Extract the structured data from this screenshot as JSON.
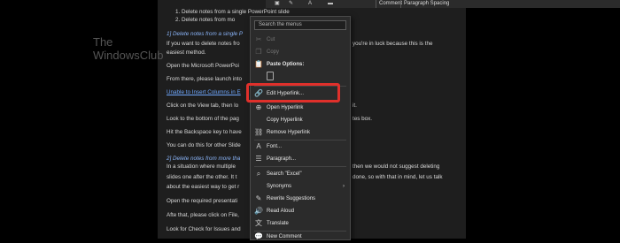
{
  "toolbar": {
    "comment_label": "Comment",
    "paragraph_spacing_label": "Paragraph Spacing",
    "icons": [
      "format-icon",
      "paint-icon"
    ]
  },
  "watermark": {
    "line1": "The",
    "line2": "WindowsClub"
  },
  "document": {
    "list_item_1": "1.   Delete notes from a single PowerPoint slide",
    "list_item_2": "2.   Delete notes from mo",
    "heading_1": "1] Delete notes from a single P",
    "para_1": "If you want to delete notes fro",
    "para_1_right": "you're in luck because this is the",
    "para_1b": "easiest method.",
    "para_2": "Open the Microsoft PowerPoi",
    "para_3": "From there, please launch into",
    "link_1": "Unable to Insert Columns in E",
    "para_4": "Click on the View tab, then lo",
    "para_4_right": "it.",
    "para_5": "Look to the bottom of the pag",
    "para_5_right": "tes box.",
    "para_6": "Hit the Backspace key to have",
    "para_7": "You can do this for other Slide",
    "heading_2": "2] Delete notes from more tha",
    "para_8": "In a situation where multiple",
    "para_8_right": "then we would not suggest deleting",
    "para_9": "slides one after the other. It t",
    "para_9_right": "done, so with that in mind, let us talk",
    "para_10": "about the easiest way to get r",
    "para_11": "Open the required presentati",
    "para_12": "Afte that, please click on File,",
    "para_13": "Look for Check for Issues and"
  },
  "context_menu": {
    "search_placeholder": "Search the menus",
    "cut": "Cut",
    "copy": "Copy",
    "paste_options": "Paste Options:",
    "edit_hyperlink": "Edit Hyperlink...",
    "open_hyperlink": "Open Hyperlink",
    "copy_hyperlink": "Copy Hyperlink",
    "remove_hyperlink": "Remove Hyperlink",
    "font": "Font...",
    "paragraph": "Paragraph...",
    "search_excel": "Search \"Excel\"",
    "synonyms": "Synonyms",
    "rewrite": "Rewrite Suggestions",
    "read_aloud": "Read Aloud",
    "translate": "Translate",
    "new_comment": "New Comment"
  }
}
